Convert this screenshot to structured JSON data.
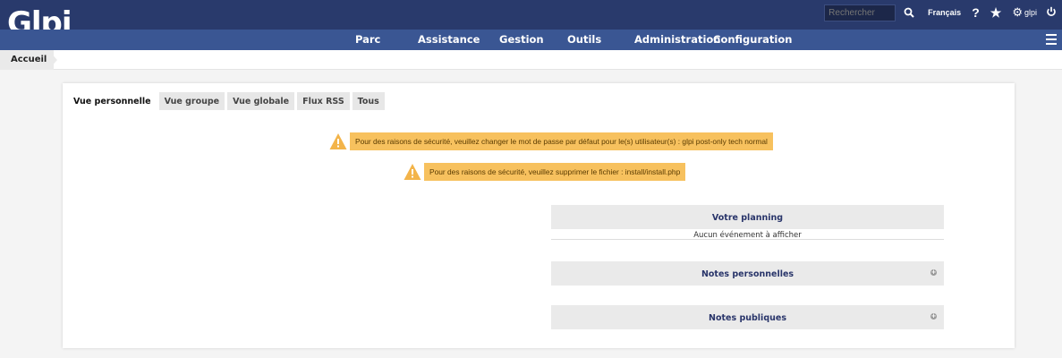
{
  "header": {
    "logo": "Glpi",
    "search_placeholder": "Rechercher",
    "language": "Français",
    "help_glyph": "?",
    "favorite_glyph": "★",
    "user": "glpi",
    "icons": [
      "search-icon",
      "help-icon",
      "star-icon",
      "gear-icon",
      "power-icon",
      "hamburger-icon"
    ]
  },
  "menu": {
    "items": [
      "Parc",
      "Assistance",
      "Gestion",
      "Outils",
      "Administration",
      "Configuration"
    ]
  },
  "breadcrumb": {
    "home": "Accueil"
  },
  "tabs": [
    "Vue personnelle",
    "Vue groupe",
    "Vue globale",
    "Flux RSS",
    "Tous"
  ],
  "alerts": [
    "Pour des raisons de sécurité, veuillez changer le mot de passe par défaut pour le(s) utilisateur(s) : glpi post-only tech normal",
    "Pour des raisons de sécurité, veuillez supprimer le fichier : install/install.php"
  ],
  "planning": {
    "title": "Votre planning",
    "empty": "Aucun événement à afficher"
  },
  "notes_personal": {
    "title": "Notes personnelles"
  },
  "notes_public": {
    "title": "Notes publiques"
  },
  "colors": {
    "topbar": "#293a6c",
    "menubar": "#3a5693",
    "alert": "#f7c15e",
    "box_title": "#29356a"
  }
}
